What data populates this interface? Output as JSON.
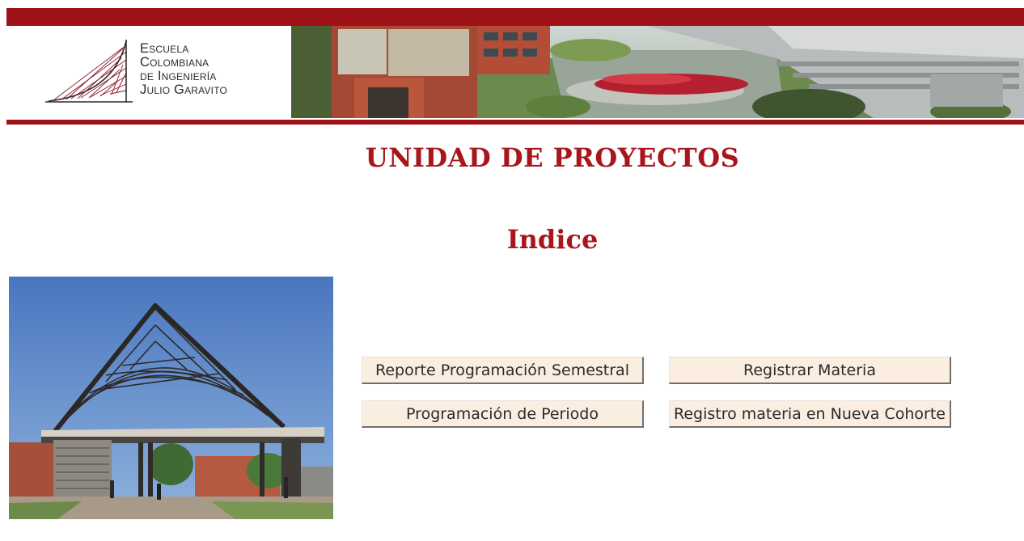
{
  "header": {
    "logo_lines": [
      "Escuela",
      "Colombiana",
      "de Ingeniería",
      "Julio Garavito"
    ],
    "brand_color": "#9f1218"
  },
  "main": {
    "title": "UNIDAD DE PROYECTOS",
    "section_title": "Indice",
    "title_color": "#a8161c",
    "buttons": [
      {
        "label": "Reporte Programación Semestral"
      },
      {
        "label": "Registrar Materia"
      },
      {
        "label": "Programación de Periodo"
      },
      {
        "label": "Registro materia en Nueva Cohorte"
      }
    ],
    "button_color": "#fbeee1"
  },
  "images": {
    "banner_photo": "campus-aerial-photo",
    "side_photo": "campus-gate-photo"
  }
}
